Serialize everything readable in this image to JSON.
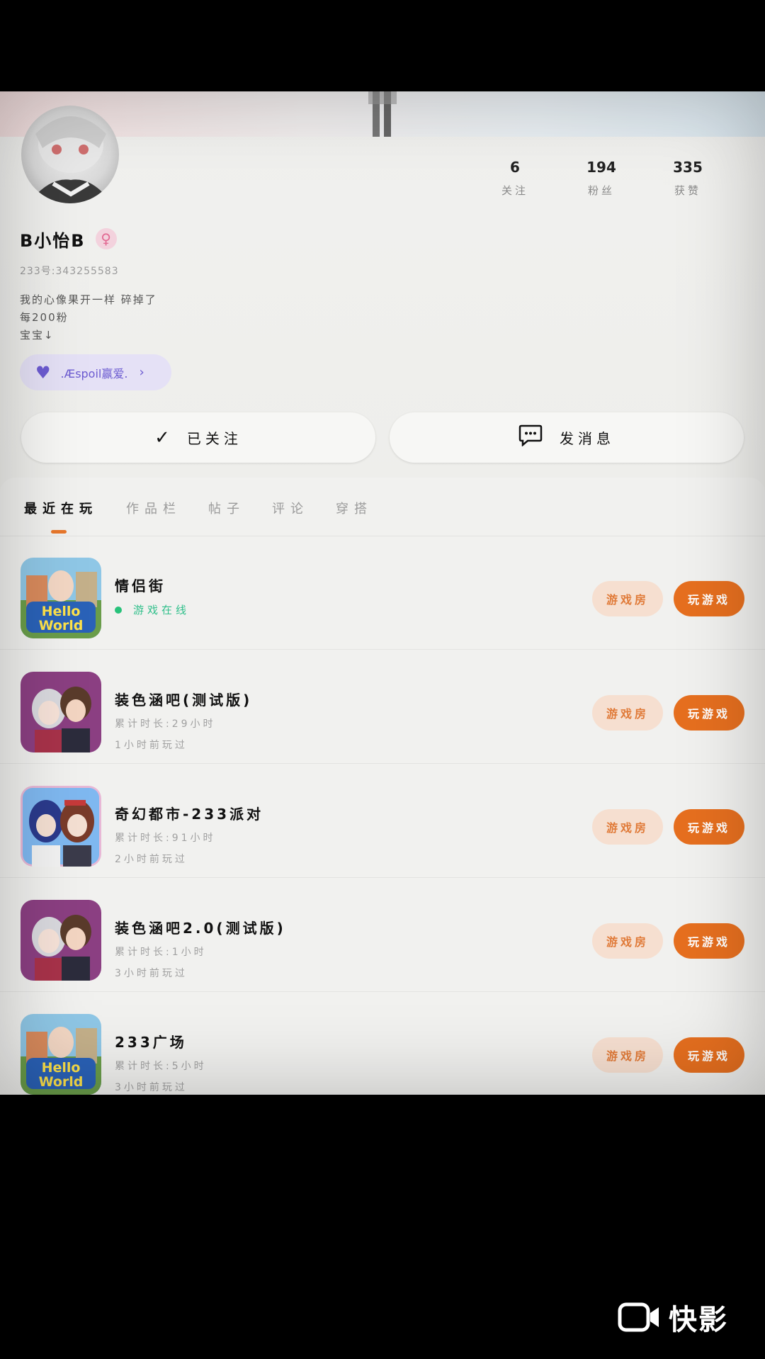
{
  "profile": {
    "username": "B小怡B",
    "gender_symbol": "♀",
    "uid": "233号:343255583",
    "bio_lines": [
      "我的心像果开一样 碎掉了",
      "每200粉",
      "宝宝↓"
    ],
    "tag_label": ".Æspoil赢爱.",
    "stats": [
      {
        "value": "6",
        "label": "关注"
      },
      {
        "value": "194",
        "label": "粉丝"
      },
      {
        "value": "335",
        "label": "获赞"
      }
    ]
  },
  "actions": {
    "follow_label": "已关注",
    "message_label": "发消息"
  },
  "tabs": [
    {
      "label": "最近在玩",
      "active": true
    },
    {
      "label": "作品栏",
      "active": false
    },
    {
      "label": "帖子",
      "active": false
    },
    {
      "label": "评论",
      "active": false
    },
    {
      "label": "穿搭",
      "active": false
    }
  ],
  "games": [
    {
      "title": "情侣街",
      "online_text": "游戏在线",
      "sub1": "",
      "sub2": "",
      "room_label": "游戏房",
      "play_label": "玩游戏",
      "thumb": "hello-world"
    },
    {
      "title": "装色涵吧(测试版)",
      "online_text": "",
      "sub1": "累计时长:29小时",
      "sub2": "1小时前玩过",
      "room_label": "游戏房",
      "play_label": "玩游戏",
      "thumb": "anime-couple"
    },
    {
      "title": "奇幻都市-233派对",
      "online_text": "",
      "sub1": "累计时长:91小时",
      "sub2": "2小时前玩过",
      "room_label": "游戏房",
      "play_label": "玩游戏",
      "thumb": "anime-girls"
    },
    {
      "title": "装色涵吧2.0(测试版)",
      "online_text": "",
      "sub1": "累计时长:1小时",
      "sub2": "3小时前玩过",
      "room_label": "游戏房",
      "play_label": "玩游戏",
      "thumb": "anime-couple"
    },
    {
      "title": "233广场",
      "online_text": "",
      "sub1": "累计时长:5小时",
      "sub2": "3小时前玩过",
      "room_label": "游戏房",
      "play_label": "玩游戏",
      "thumb": "hello-world"
    }
  ],
  "thumb_text": {
    "hello_world": "Hello World"
  },
  "watermark": {
    "text": "快影"
  },
  "colors": {
    "accent_orange": "#e66f1f",
    "room_bg": "#f6dfd0",
    "online_green": "#28c27a",
    "tag_purple": "#6c5bd1"
  }
}
